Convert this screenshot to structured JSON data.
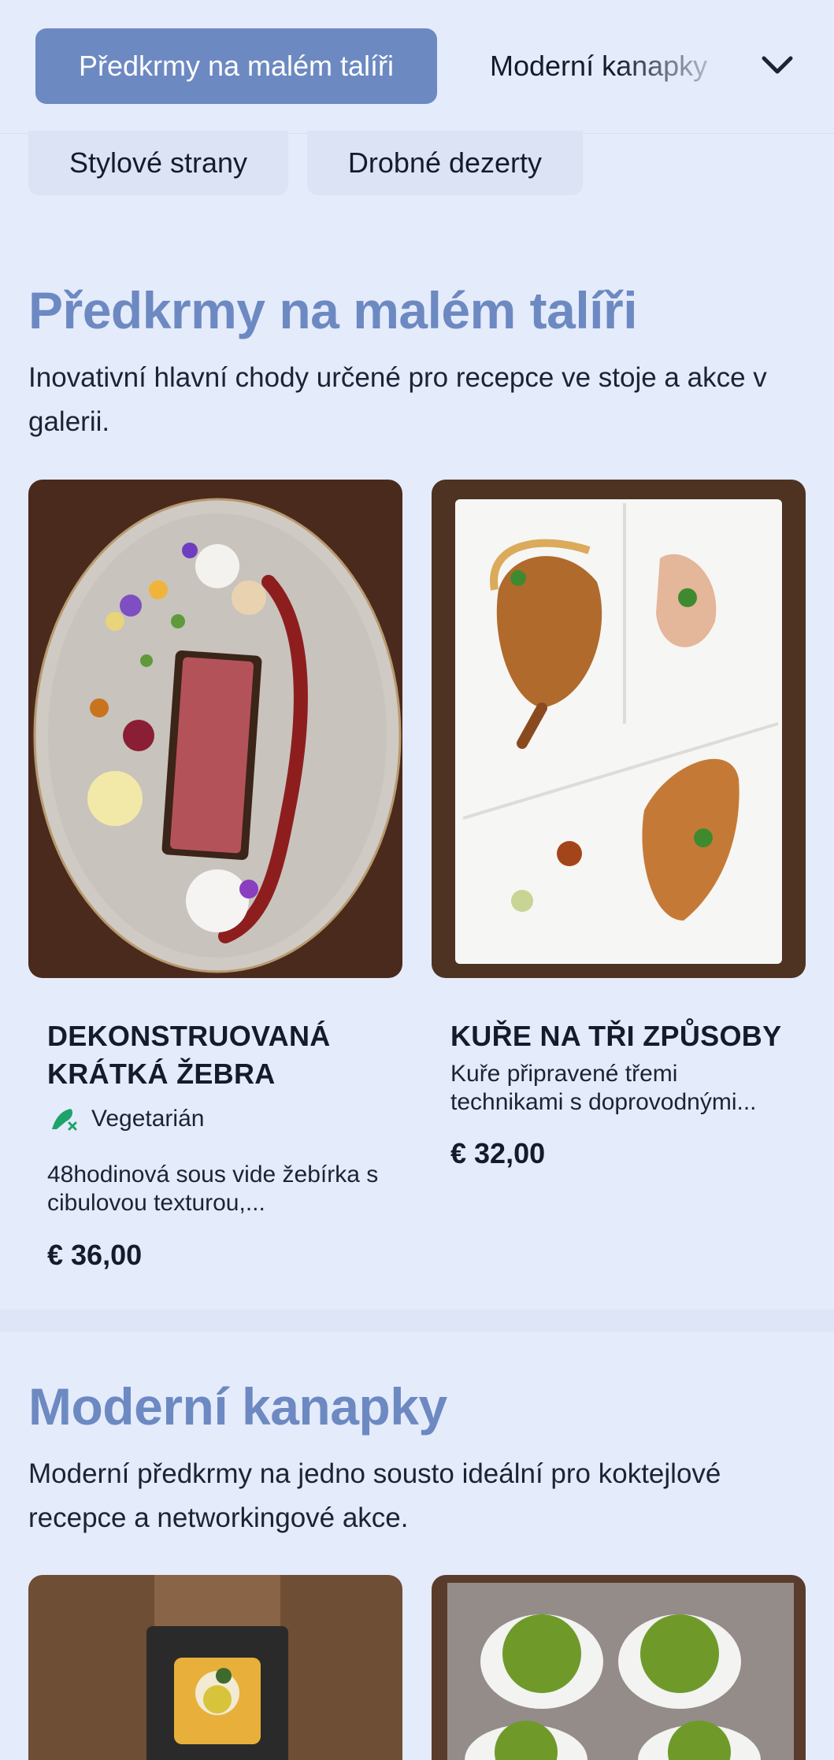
{
  "nav": {
    "active_category": "Předkrmy na malém talíři",
    "tabs": [
      "Moderní kanapky"
    ],
    "pills": [
      "Stylové strany",
      "Drobné dezerty"
    ]
  },
  "sections": [
    {
      "title": "Předkrmy na malém talíři",
      "description": "Inovativní hlavní chody určené pro recepce ve stoje a akce v galerii.",
      "items": [
        {
          "name": "DEKONSTRUOVANÁ KRÁTKÁ ŽEBRA",
          "diet": "Vegetarián",
          "description": "48hodinová sous vide žebírka s cibulovou texturou,...",
          "price": "€ 36,00"
        },
        {
          "name": "KUŘE NA TŘI ZPŮSOBY",
          "description": "Kuře připravené třemi technikami s doprovodnými...",
          "price": "€ 32,00"
        }
      ]
    },
    {
      "title": "Moderní kanapky",
      "description": "Moderní předkrmy na jedno sousto ideální pro koktejlové recepce a networkingové akce."
    }
  ],
  "colors": {
    "accent": "#6d89c2",
    "background": "#e4ebfb",
    "diet_icon": "#1fa36b"
  }
}
